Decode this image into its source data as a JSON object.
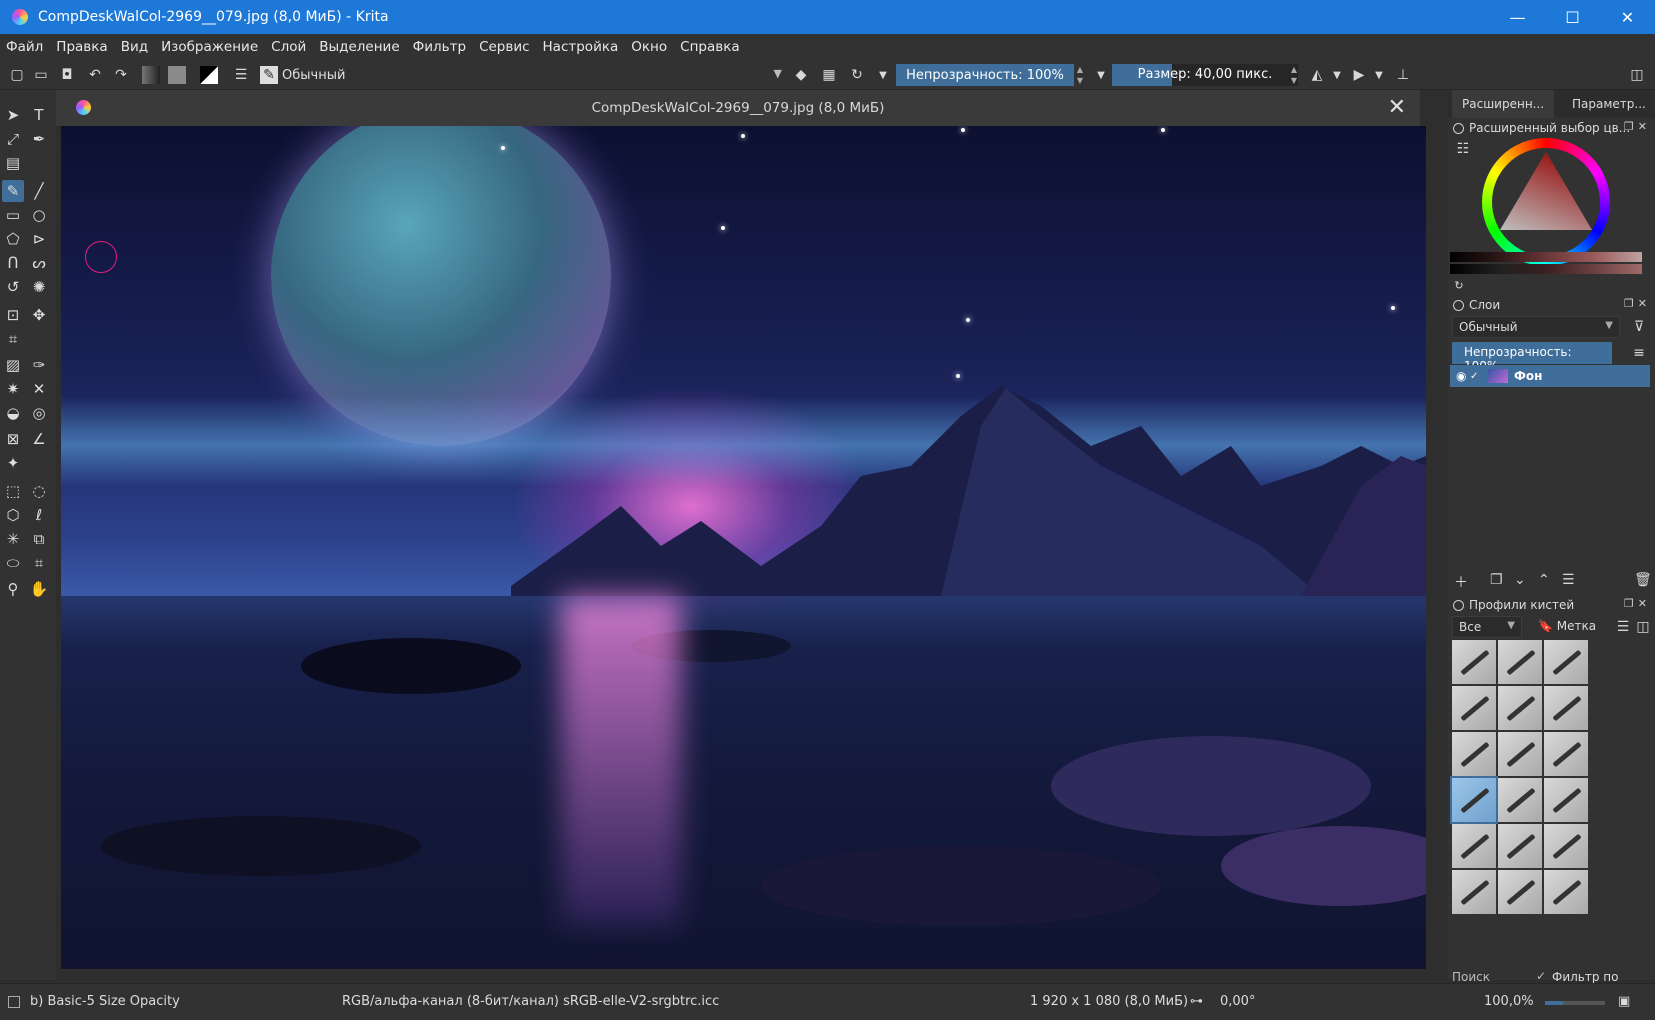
{
  "window": {
    "title": "CompDeskWalCol-2969__079.jpg (8,0 МиБ) - Krita",
    "minimize": "—",
    "maximize": "☐",
    "close": "✕"
  },
  "menu": [
    "Файл",
    "Правка",
    "Вид",
    "Изображение",
    "Слой",
    "Выделение",
    "Фильтр",
    "Сервис",
    "Настройка",
    "Окно",
    "Справка"
  ],
  "toolbar": {
    "preset_name": "Обычный",
    "opacity": "Непрозрачность: 100%",
    "size": "Размер: 40,00 пикс."
  },
  "document": {
    "title": "CompDeskWalCol-2969__079.jpg (8,0 МиБ)",
    "close": "✕"
  },
  "dock": {
    "tabs": [
      "Расширенн...",
      "Параметр..."
    ],
    "color_panel_title": "Расширенный выбор цв...",
    "layers_panel_title": "Слои",
    "blend_mode": "Обычный",
    "layer_opacity": "Непрозрачность: 100%",
    "layers": [
      {
        "name": "Фон",
        "visible": true
      }
    ],
    "brushes_panel_title": "Профили кистей",
    "brush_filter": "Все",
    "brush_tag": "Метка",
    "brush_search": "Поиск",
    "filter_by_tag": "Фильтр по метке"
  },
  "status": {
    "brush": "b) Basic-5 Size Opacity",
    "color_profile": "RGB/альфа-канал (8-бит/канал)  sRGB-elle-V2-srgbtrc.icc",
    "image_size": "1 920 x 1 080 (8,0 МиБ)",
    "rotation": "0,00°",
    "zoom": "100,0%"
  }
}
